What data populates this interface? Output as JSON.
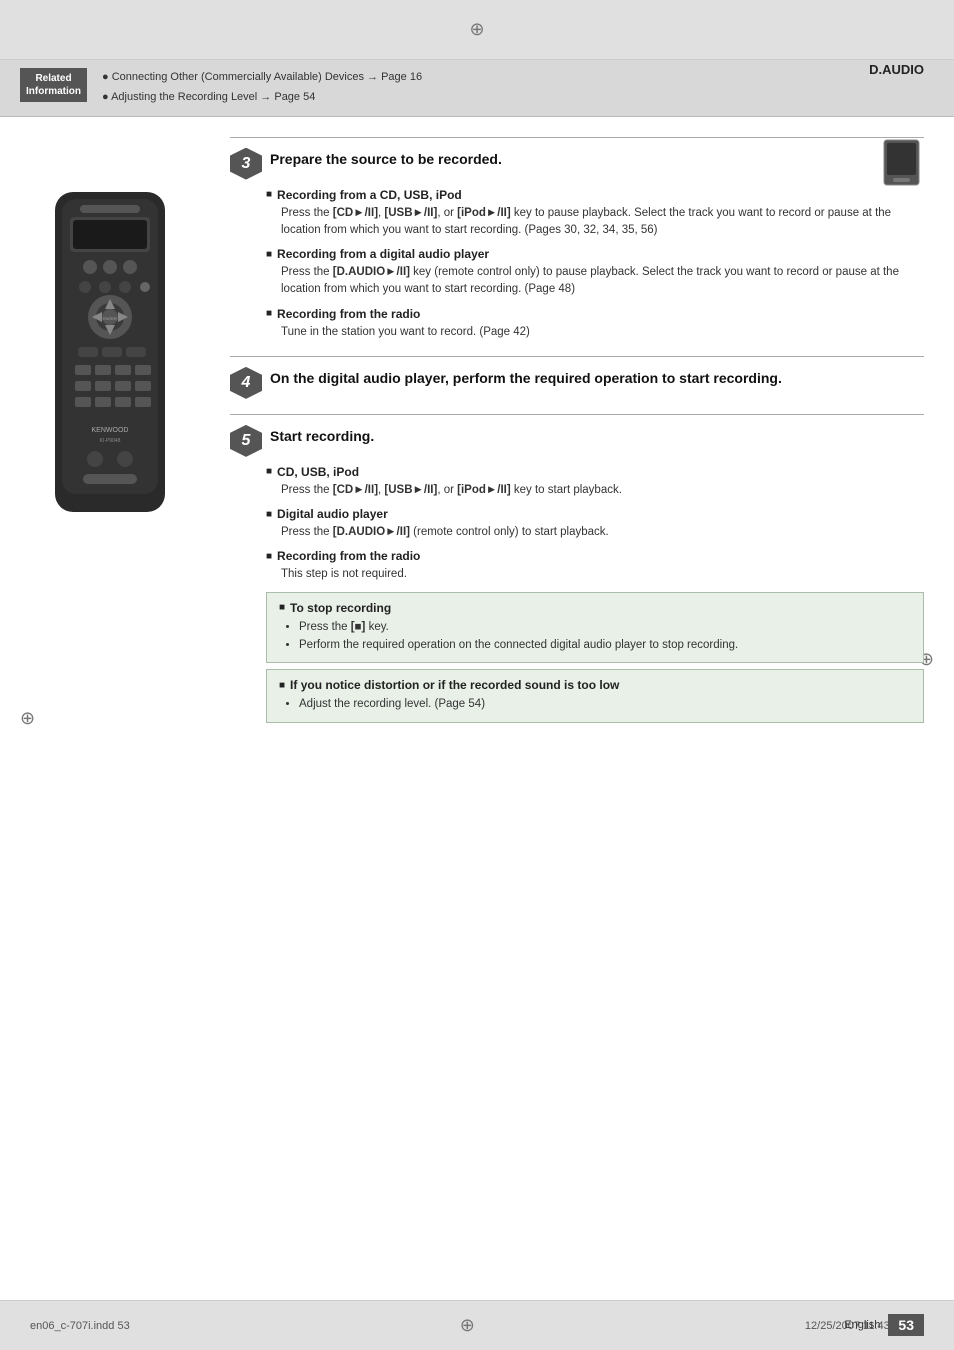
{
  "page": {
    "title": "D.AUDIO",
    "page_number": "53",
    "language": "English",
    "file_info": "en06_c-707i.indd  53",
    "date_info": "12/25/2007  11:43:18 AM"
  },
  "related_info": {
    "label_line1": "Related",
    "label_line2": "Information",
    "links": [
      "● Connecting Other (Commercially Available) Devices → Page 16",
      "● Adjusting the Recording Level → Page 54"
    ]
  },
  "steps": [
    {
      "number": "3",
      "title": "Prepare the source to be recorded.",
      "sub_sections": [
        {
          "id": "recording-cd-usb-ipod",
          "title": "Recording from a CD, USB, iPod",
          "text": "Press the [CD►/II], [USB►/II], or [iPod►/II] key to pause playback. Select the track you want to record or pause at the location from which you want to start recording. (Pages 30, 32, 34, 35, 56)"
        },
        {
          "id": "recording-digital-audio",
          "title": "Recording from a digital audio player",
          "text": "Press the [D.AUDIO►/II] key (remote control only) to pause playback. Select the track you want to record or pause at the location from which you want to start recording. (Page 48)"
        },
        {
          "id": "recording-radio",
          "title": "Recording from the radio",
          "text": "Tune in the station you want to record. (Page 42)"
        }
      ]
    },
    {
      "number": "4",
      "title": "On the digital audio player, perform the required operation to start recording.",
      "sub_sections": []
    },
    {
      "number": "5",
      "title": "Start recording.",
      "sub_sections": [
        {
          "id": "start-cd-usb-ipod",
          "title": "CD, USB, iPod",
          "text": "Press the [CD►/II], [USB►/II], or [iPod►/II] key to start playback."
        },
        {
          "id": "start-digital-audio",
          "title": "Digital audio player",
          "text": "Press the [D.AUDIO►/II] (remote control only) to start playback."
        },
        {
          "id": "start-radio",
          "title": "Recording from the radio",
          "text": "This step is not required."
        }
      ],
      "highlight_boxes": [
        {
          "id": "stop-recording",
          "title": "To stop recording",
          "items": [
            "Press the [■] key.",
            "Perform the required operation on the connected digital audio player to stop recording."
          ]
        },
        {
          "id": "distortion-notice",
          "title": "If you notice distortion or if the recorded sound is too low",
          "items": [
            "Adjust the recording level. (Page 54)"
          ]
        }
      ]
    }
  ],
  "icons": {
    "compass_symbol": "⊕",
    "bullet": "●",
    "square_bullet": "■"
  }
}
